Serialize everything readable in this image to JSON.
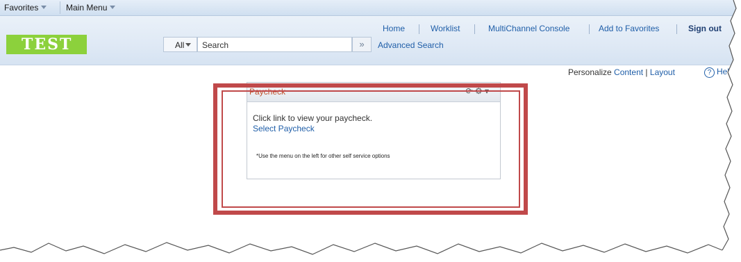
{
  "menubar": {
    "favorites": "Favorites",
    "main_menu": "Main Menu"
  },
  "header": {
    "logo": "TEST",
    "nav": [
      "Home",
      "Worklist",
      "MultiChannel Console",
      "Add to Favorites",
      "Sign out"
    ],
    "search": {
      "scope": "All",
      "placeholder": "Search",
      "go": "»",
      "advanced": "Advanced Search"
    }
  },
  "personalize": {
    "label": "Personalize",
    "content": "Content",
    "sep": "|",
    "layout": "Layout",
    "help": "Hel"
  },
  "pagelet": {
    "title": "Paycheck",
    "tools": "⟳  ⚙ ▾",
    "body_text": "Click link to view your paycheck.",
    "link": "Select Paycheck",
    "note": "*Use the menu on the left for other self service options"
  },
  "colors": {
    "logo_bg": "#8cd13c",
    "frame": "#c0494a",
    "link": "#1f5ea8",
    "pagelet_title": "#c0532f"
  }
}
